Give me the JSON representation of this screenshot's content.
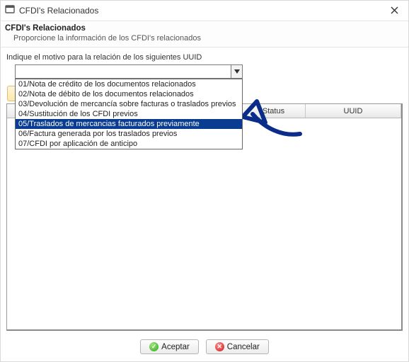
{
  "window": {
    "title": "CFDI's Relacionados"
  },
  "header": {
    "title": "CFDI's Relacionados",
    "subtitle": "Proporcione la información de los CFDI's relacionados"
  },
  "prompt": "Indique el motivo para la relación de los siguientes UUID",
  "combo": {
    "value": "",
    "options": [
      "01/Nota de crédito de los documentos relacionados",
      "02/Nota de débito de los documentos relacionados",
      "03/Devolución de mercancía sobre facturas o traslados previos",
      "04/Sustitución de los CFDI previos",
      "05/Traslados de mercancias facturados previamente",
      "06/Factura generada por los traslados previos",
      "07/CFDI por aplicación de anticipo"
    ],
    "highlighted_index": 4
  },
  "grid": {
    "columns": {
      "c1": "",
      "c2": "Status",
      "c3": "UUID"
    },
    "rows": []
  },
  "buttons": {
    "accept": "Aceptar",
    "cancel": "Cancelar"
  }
}
